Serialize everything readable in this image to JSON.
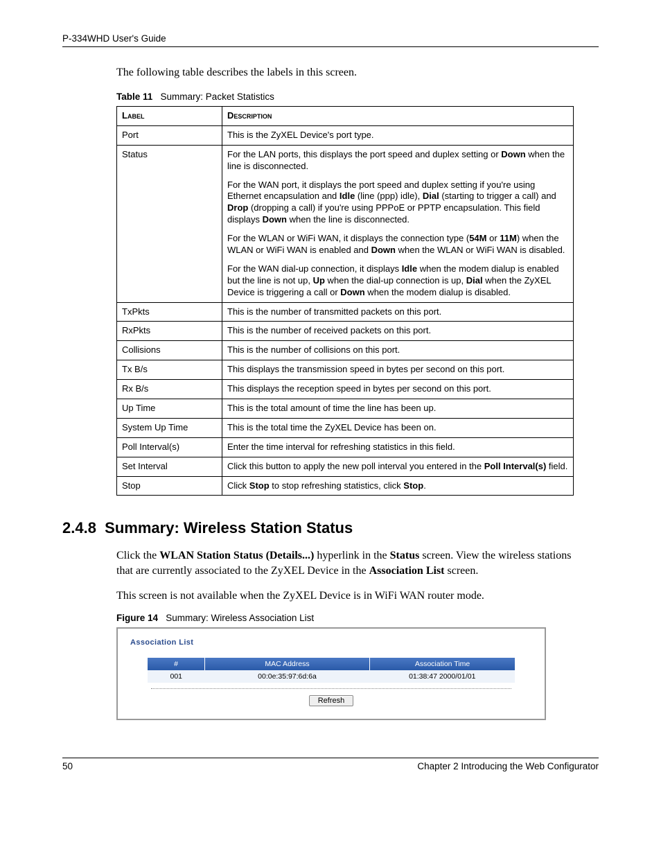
{
  "header": {
    "guide_title": "P-334WHD User's Guide"
  },
  "intro": "The following table describes the labels in this screen.",
  "table11": {
    "caption_label": "Table 11",
    "caption_text": "Summary: Packet Statistics",
    "col_label": "Label",
    "col_desc": "Description",
    "rows": {
      "port": {
        "label": "Port",
        "desc": "This is the ZyXEL Device's port type."
      },
      "status": {
        "label": "Status",
        "p1a": "For the LAN ports, this displays the port speed and duplex setting or ",
        "p1b": "Down",
        "p1c": " when the line is disconnected.",
        "p2a": "For the WAN port, it displays the port speed and duplex setting if you're using Ethernet encapsulation and ",
        "p2b": "Idle",
        "p2c": " (line (ppp) idle), ",
        "p2d": "Dial",
        "p2e": " (starting to trigger a call) and ",
        "p2f": "Drop",
        "p2g": " (dropping a call) if you're using PPPoE or PPTP encapsulation. This field displays ",
        "p2h": "Down",
        "p2i": " when the line is disconnected.",
        "p3a": "For the WLAN or WiFi WAN, it displays the connection type (",
        "p3b": "54M",
        "p3c": " or ",
        "p3d": "11M",
        "p3e": ") when the WLAN or WiFi WAN is enabled and ",
        "p3f": "Down",
        "p3g": " when the WLAN or WiFi WAN is disabled.",
        "p4a": "For the WAN dial-up connection, it displays ",
        "p4b": "Idle",
        "p4c": " when the modem dialup is enabled but the line is not up, ",
        "p4d": "Up",
        "p4e": " when the dial-up connection is up, ",
        "p4f": "Dial",
        "p4g": " when the ZyXEL Device is triggering a call or ",
        "p4h": "Down",
        "p4i": " when the modem dialup is disabled."
      },
      "txpkts": {
        "label": "TxPkts",
        "desc": "This is the number of transmitted packets on this port."
      },
      "rxpkts": {
        "label": "RxPkts",
        "desc": "This is the number of received packets on this port."
      },
      "collisions": {
        "label": "Collisions",
        "desc": "This is the number of collisions on this port."
      },
      "txbs": {
        "label": "Tx B/s",
        "desc": "This displays the transmission speed in bytes per second on this port."
      },
      "rxbs": {
        "label": "Rx B/s",
        "desc": "This displays the reception speed in bytes per second on this port."
      },
      "uptime": {
        "label": "Up Time",
        "desc": "This is the total amount of time the line has been up."
      },
      "sysuptime": {
        "label": "System Up Time",
        "desc": "This is the total time the ZyXEL Device has been on."
      },
      "poll": {
        "label": "Poll Interval(s)",
        "desc": "Enter the time interval for refreshing statistics in this field."
      },
      "setint": {
        "label": "Set Interval",
        "a": "Click this button to apply the new poll interval you entered in the ",
        "b": "Poll Interval(s)",
        "c": " field."
      },
      "stop": {
        "label": "Stop",
        "a": "Click ",
        "b": "Stop",
        "c": " to stop refreshing statistics, click ",
        "d": "Stop",
        "e": "."
      }
    }
  },
  "section": {
    "number": "2.4.8",
    "title": "Summary: Wireless Station Status",
    "p1a": "Click the ",
    "p1b": "WLAN Station Status (Details...)",
    "p1c": " hyperlink in the ",
    "p1d": "Status",
    "p1e": " screen. View the wireless stations that are currently associated to the ZyXEL Device in the ",
    "p1f": "Association List",
    "p1g": " screen.",
    "p2": "This screen is not available when the ZyXEL Device is in WiFi WAN router mode."
  },
  "figure14": {
    "caption_label": "Figure 14",
    "caption_text": "Summary: Wireless Association List",
    "panel_title": "Association List",
    "col_num": "#",
    "col_mac": "MAC Address",
    "col_time": "Association Time",
    "row_num": "001",
    "row_mac": "00:0e:35:97:6d:6a",
    "row_time": "01:38:47 2000/01/01",
    "refresh": "Refresh"
  },
  "footer": {
    "page": "50",
    "chapter": "Chapter 2 Introducing the Web Configurator"
  }
}
